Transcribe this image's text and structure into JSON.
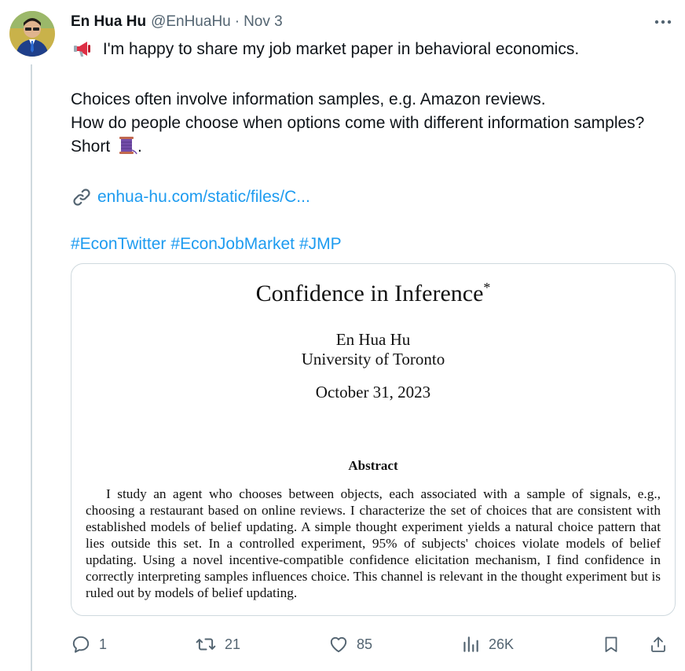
{
  "author": {
    "name": "En Hua Hu",
    "handle": "@EnHuaHu",
    "separator": "·",
    "date": "Nov 3"
  },
  "tweet": {
    "line1": "I'm happy to share my job market paper in behavioral economics.",
    "line2": "Choices often involve information samples, e.g. Amazon reviews.",
    "line3": "How do people choose when options come with different information samples? Short",
    "line3_end": ".",
    "link": "enhua-hu.com/static/files/C...",
    "hashtags": [
      "#EconTwitter",
      "#EconJobMarket",
      "#JMP"
    ]
  },
  "paper": {
    "title": "Confidence in Inference",
    "title_mark": "*",
    "author": "En Hua Hu",
    "affiliation": "University of Toronto",
    "date": "October 31, 2023",
    "abstract_heading": "Abstract",
    "abstract": "I study an agent who chooses between objects, each associated with a sample of signals, e.g., choosing a restaurant based on online reviews. I characterize the set of choices that are consistent with established models of belief updating. A simple thought experiment yields a natural choice pattern that lies outside this set. In a controlled experiment, 95% of subjects' choices violate models of belief updating. Using a novel incentive-compatible confidence elicitation mechanism, I find confidence in correctly interpreting samples influences choice. This channel is relevant in the thought experiment but is ruled out by models of belief updating."
  },
  "actions": {
    "replies": "1",
    "reposts": "21",
    "likes": "85",
    "views": "26K"
  },
  "icons": {
    "megaphone": "megaphone-icon",
    "thread": "thread-spool-icon",
    "link": "link-icon",
    "more": "more-icon",
    "reply": "reply-icon",
    "repost": "repost-icon",
    "like": "like-icon",
    "views": "views-icon",
    "bookmark": "bookmark-icon",
    "share": "share-icon"
  },
  "colors": {
    "text": "#0f1419",
    "secondary": "#536471",
    "accent": "#1d9bf0",
    "border": "#cfd9de"
  }
}
